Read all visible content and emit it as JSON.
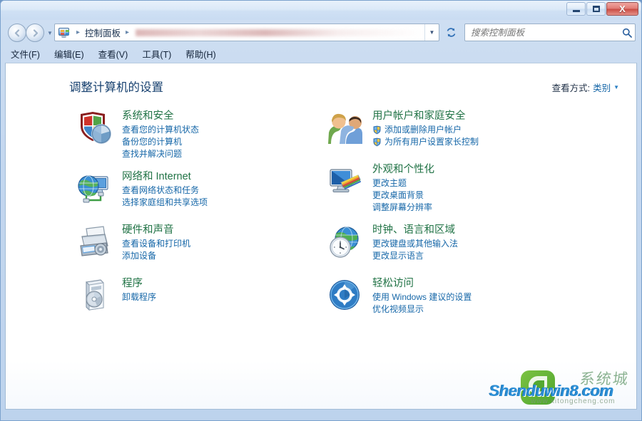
{
  "window": {
    "buttons": {
      "minimize": "minimize",
      "maximize": "maximize",
      "close": "X"
    }
  },
  "addressbar": {
    "icon": "control-panel-icon",
    "crumb_root": "控制面板",
    "separator": "▸",
    "dropdown": "▼",
    "refresh": "↻"
  },
  "search": {
    "placeholder": "搜索控制面板",
    "value": "",
    "icon": "search-icon"
  },
  "menu": {
    "items": [
      {
        "label": "文件(F)"
      },
      {
        "label": "编辑(E)"
      },
      {
        "label": "查看(V)"
      },
      {
        "label": "工具(T)"
      },
      {
        "label": "帮助(H)"
      }
    ]
  },
  "main": {
    "title": "调整计算机的设置",
    "view_by_label": "查看方式:",
    "view_by_value": "类别",
    "view_by_caret": "▼",
    "left_column": [
      {
        "title": "系统和安全",
        "icon": "security-shield-icon",
        "links": [
          {
            "label": "查看您的计算机状态",
            "shield": false
          },
          {
            "label": "备份您的计算机",
            "shield": false
          },
          {
            "label": "查找并解决问题",
            "shield": false
          }
        ]
      },
      {
        "title": "网络和 Internet",
        "icon": "network-globe-icon",
        "links": [
          {
            "label": "查看网络状态和任务",
            "shield": false
          },
          {
            "label": "选择家庭组和共享选项",
            "shield": false
          }
        ]
      },
      {
        "title": "硬件和声音",
        "icon": "printer-device-icon",
        "links": [
          {
            "label": "查看设备和打印机",
            "shield": false
          },
          {
            "label": "添加设备",
            "shield": false
          }
        ]
      },
      {
        "title": "程序",
        "icon": "programs-box-icon",
        "links": [
          {
            "label": "卸载程序",
            "shield": false
          }
        ]
      }
    ],
    "right_column": [
      {
        "title": "用户帐户和家庭安全",
        "icon": "user-accounts-icon",
        "links": [
          {
            "label": "添加或删除用户帐户",
            "shield": true
          },
          {
            "label": "为所有用户设置家长控制",
            "shield": true
          }
        ]
      },
      {
        "title": "外观和个性化",
        "icon": "appearance-monitor-icon",
        "links": [
          {
            "label": "更改主题",
            "shield": false
          },
          {
            "label": "更改桌面背景",
            "shield": false
          },
          {
            "label": "调整屏幕分辨率",
            "shield": false
          }
        ]
      },
      {
        "title": "时钟、语言和区域",
        "icon": "clock-globe-icon",
        "links": [
          {
            "label": "更改键盘或其他输入法",
            "shield": false
          },
          {
            "label": "更改显示语言",
            "shield": false
          }
        ]
      },
      {
        "title": "轻松访问",
        "icon": "ease-of-access-icon",
        "links": [
          {
            "label": "使用 Windows 建议的设置",
            "shield": false
          },
          {
            "label": "优化视频显示",
            "shield": false
          }
        ]
      }
    ]
  },
  "watermark": {
    "text": "Shenduwin8.com",
    "cn": "系统城",
    "sub": "www.xitongcheng.com"
  },
  "colors": {
    "category_title": "#217346",
    "link": "#1667a8",
    "page_title": "#16406f",
    "close_button": "#c94b43"
  }
}
